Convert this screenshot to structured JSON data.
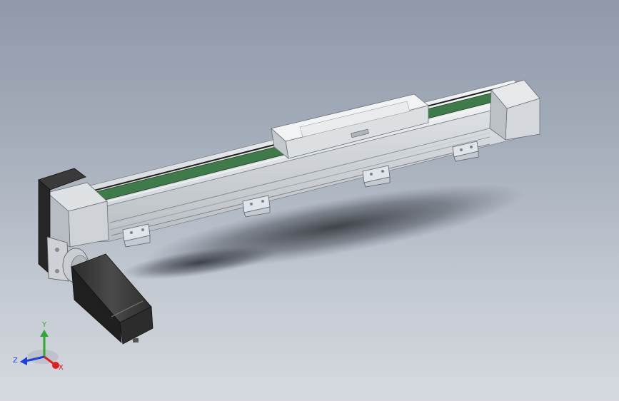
{
  "viewport": {
    "background_top": "#8f99a8",
    "background_bottom": "#d6dae0"
  },
  "model": {
    "description_icon": "linear-actuator-model",
    "belt_color": "#3e7a4a",
    "frame_color": "#e4e7ea",
    "motor_color": "#3a3a3a"
  },
  "triad": {
    "x_label": "X",
    "y_label": "Y",
    "z_label": "Z",
    "x_color": "#e02020",
    "y_color": "#2fa82f",
    "z_color": "#2040d8"
  }
}
